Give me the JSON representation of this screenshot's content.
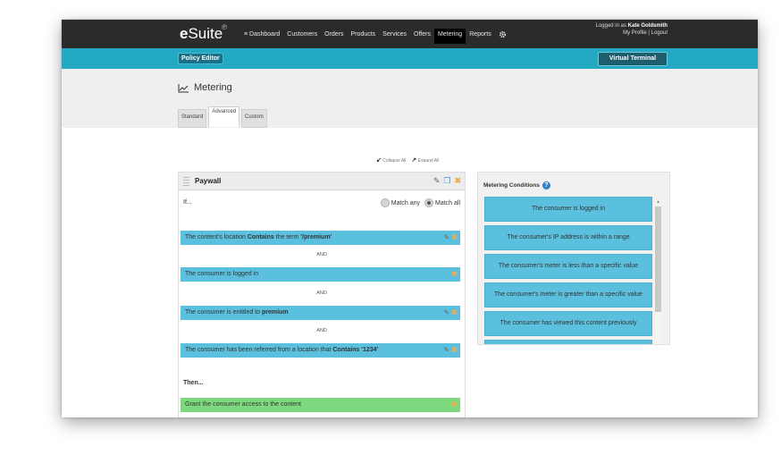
{
  "header": {
    "logo": "Suite",
    "logo_bold": "e",
    "logo_symbol": "℗",
    "nav": [
      "Dashboard",
      "Customers",
      "Orders",
      "Products",
      "Services",
      "Offers",
      "Metering",
      "Reports"
    ],
    "nav_menu_icon": "≡",
    "login_prefix": "Logged in as",
    "login_user": "Kate Goldsmith",
    "login_links": "My Profile | Logout"
  },
  "subbar": {
    "policy_editor": "Policy Editor",
    "virtual_terminal": "Virtual Terminal"
  },
  "page": {
    "title": "Metering",
    "tabs": [
      "Standard",
      "Advanced",
      "Custom"
    ]
  },
  "toolbar": {
    "collapse_all": "Collapse All",
    "expand_all": "Expand All"
  },
  "panel": {
    "title": "Paywall",
    "if_label": "If...",
    "match_any": "Match any",
    "match_all": "Match all",
    "selected_match": "all",
    "and_label": "AND",
    "conditions": [
      {
        "pre": "The content's location",
        "b1": "Contains",
        "mid": "the term",
        "b2": "'/premium'"
      },
      {
        "text": "The consumer is logged in"
      },
      {
        "pre": "The consumer is entitled to",
        "b1": "premium"
      },
      {
        "pre": "The consumer has been referred from a location that",
        "b1": "Contains",
        "b2": "'1234'"
      }
    ],
    "then_label": "Then...",
    "action": "Grant the consumer access to the content"
  },
  "side": {
    "title": "Metering Conditions",
    "items": [
      "The consumer is logged in",
      "The consumer's IP address is within a range",
      "The consumer's meter is less than a specific value",
      "The consumer's meter is greater than a specific value",
      "The consumer has viewed this content previously"
    ]
  },
  "colors": {
    "topbar": "#2b2b2b",
    "teal": "#23a9c2",
    "condition": "#5bc0de",
    "action": "#7ed97e"
  }
}
